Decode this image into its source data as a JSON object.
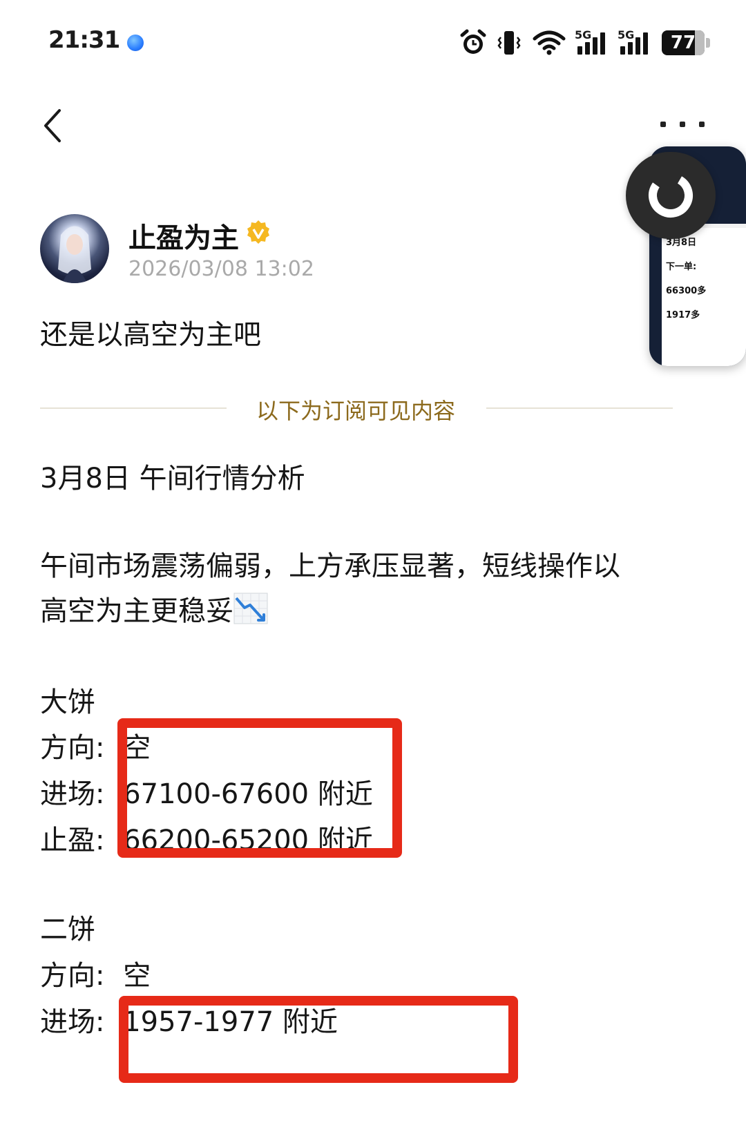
{
  "status_bar": {
    "time": "21:31",
    "network_1": "5G",
    "network_2": "5G",
    "battery": "77",
    "icons": [
      "alarm-icon",
      "vibrate-icon",
      "wifi-icon",
      "signal-icon",
      "signal-icon",
      "battery-icon"
    ]
  },
  "nav": {
    "back_icon": "chevron-left-icon",
    "more_icon": "more-horizontal-icon"
  },
  "floating_widget": {
    "lines": [
      "3月8日",
      "下一单:",
      "66300多",
      "1917多"
    ]
  },
  "post": {
    "author_name": "止盈为主",
    "verified_icon": "verified-badge-icon",
    "date": "2026/03/08 13:02",
    "lead": "还是以高空为主吧",
    "divider_label": "以下为订阅可见内容",
    "title": "3月8日 午间行情分析",
    "paragraph_line1": "午间市场震荡偏弱，上方承压显著，短线操作以",
    "paragraph_line2": "高空为主更稳妥",
    "trend_icon": "chart-decreasing-icon",
    "section1": {
      "name": "大饼",
      "direction_label": "方向:",
      "direction_value": "空",
      "entry_label": "进场:",
      "entry_value": "67100-67600 附近",
      "tp_label": "止盈:",
      "tp_value": "66200-65200 附近"
    },
    "section2": {
      "name": "二饼",
      "direction_label": "方向:",
      "direction_value": "空",
      "entry_label": "进场:",
      "entry_value": "1957-1977 附近"
    }
  },
  "colors": {
    "highlight_box": "#e62a18",
    "divider_text": "#8c6a1d",
    "verified": "#f5b821",
    "date_text": "#a9a9a9"
  }
}
